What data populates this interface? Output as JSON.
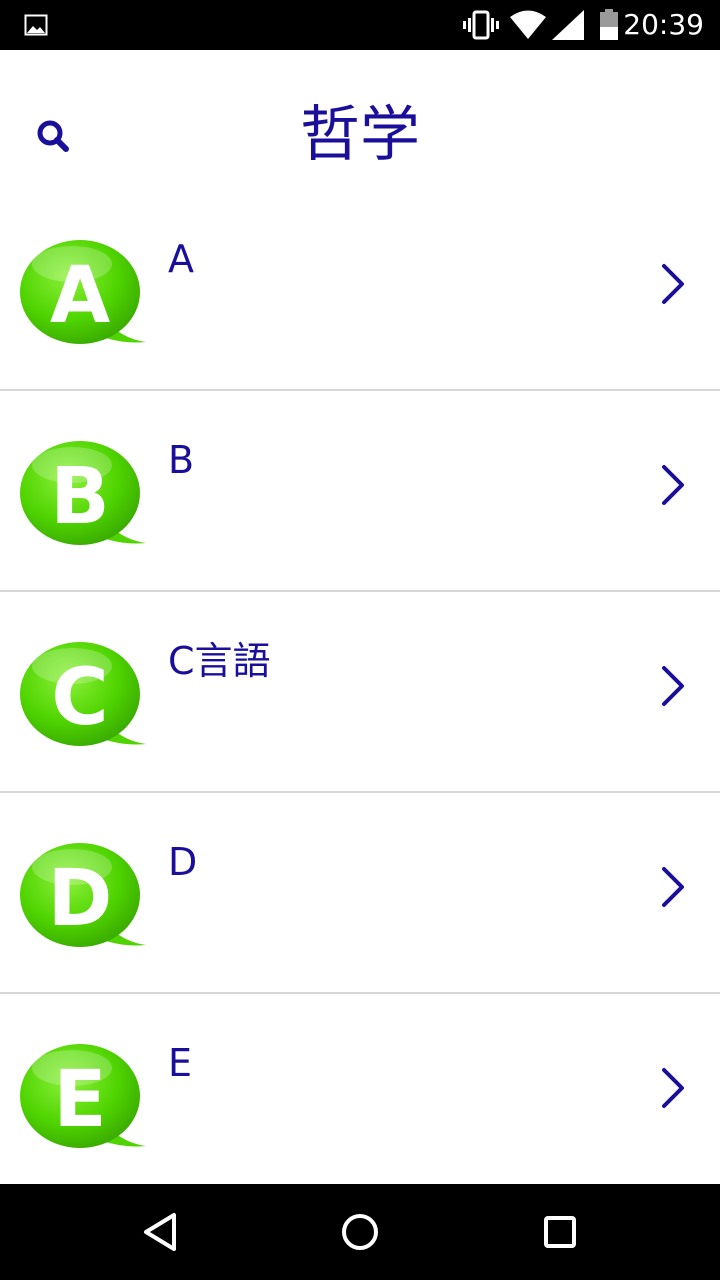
{
  "status_bar": {
    "time": "20:39",
    "icons": [
      "gallery-notification-icon",
      "vibrate-icon",
      "wifi-icon",
      "cell-signal-icon",
      "battery-icon"
    ]
  },
  "header": {
    "title": "哲学",
    "search_icon": "search-icon"
  },
  "list": {
    "items": [
      {
        "badge_letter": "A",
        "label": "A"
      },
      {
        "badge_letter": "B",
        "label": "B"
      },
      {
        "badge_letter": "C",
        "label": "C言語"
      },
      {
        "badge_letter": "D",
        "label": "D"
      },
      {
        "badge_letter": "E",
        "label": "E"
      }
    ]
  },
  "nav_bar": {
    "icons": [
      "back-icon",
      "home-icon",
      "recents-icon"
    ]
  },
  "colors": {
    "accent": "#1a0f9a",
    "bubble_green": "#4fd400",
    "divider": "#d8d8d8",
    "system_bar": "#000000"
  }
}
